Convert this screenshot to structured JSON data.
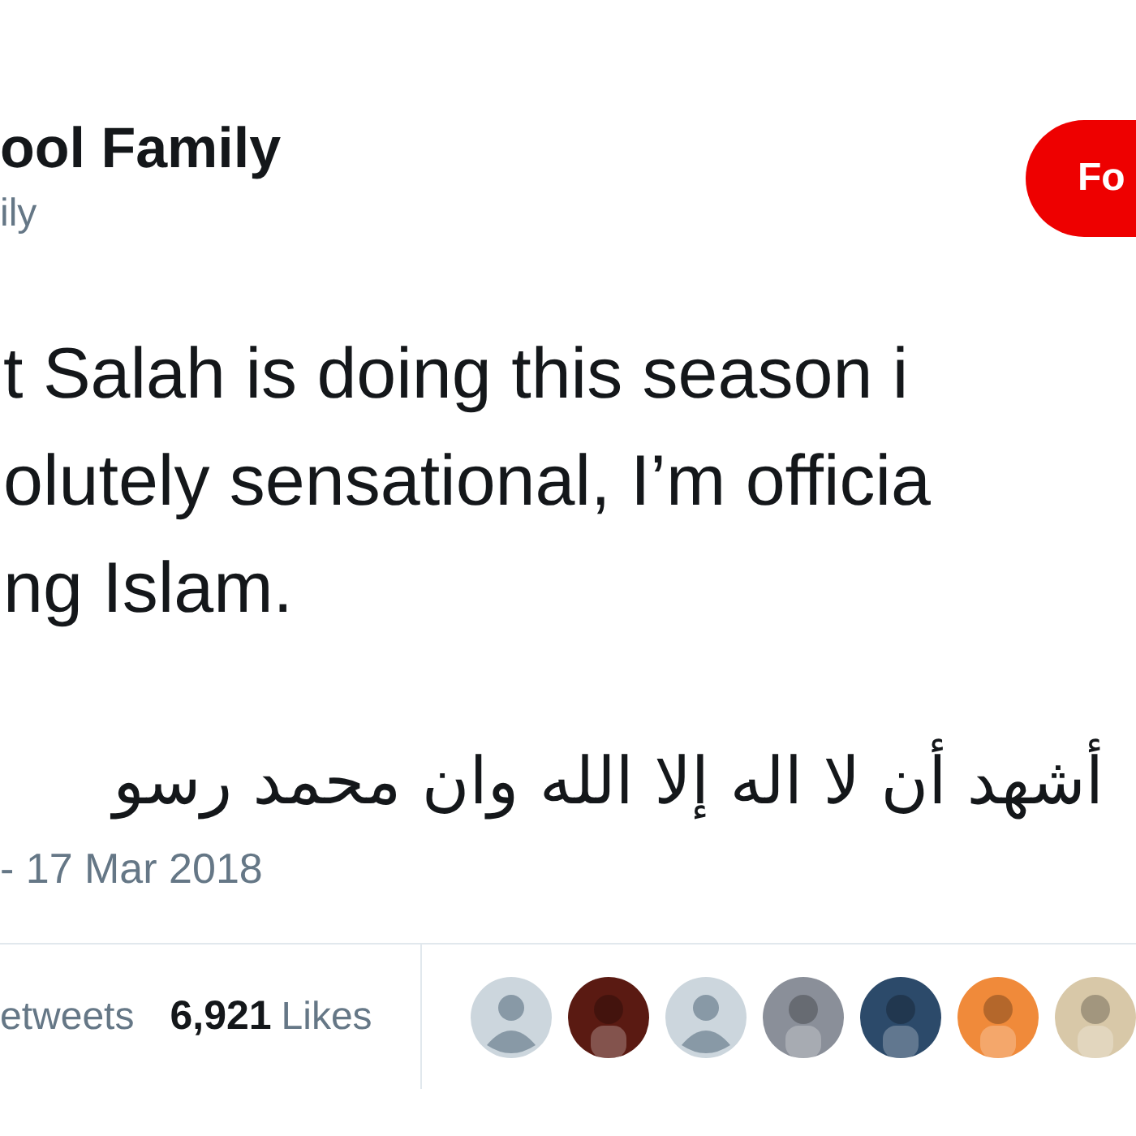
{
  "author": {
    "name": "ool Family",
    "handle": "ily"
  },
  "follow_button": {
    "label": "Fo"
  },
  "tweet": {
    "lines": [
      "t Salah is doing this season i",
      "olutely sensational, I’m officia",
      "ng Islam."
    ],
    "arabic": "أشهد أن لا اله إلا الله وان محمد رسو",
    "date": "- 17 Mar 2018"
  },
  "stats": {
    "retweets_label": "etweets",
    "likes_count": "6,921",
    "likes_label": "Likes"
  },
  "avatars": [
    {
      "kind": "silhouette"
    },
    {
      "kind": "picture",
      "color": "#5a1a12"
    },
    {
      "kind": "silhouette"
    },
    {
      "kind": "picture",
      "color": "#8a8f99"
    },
    {
      "kind": "picture",
      "color": "#2c4a6a"
    },
    {
      "kind": "picture",
      "color": "#f08a3a"
    },
    {
      "kind": "picture",
      "color": "#d8c8a8"
    }
  ]
}
